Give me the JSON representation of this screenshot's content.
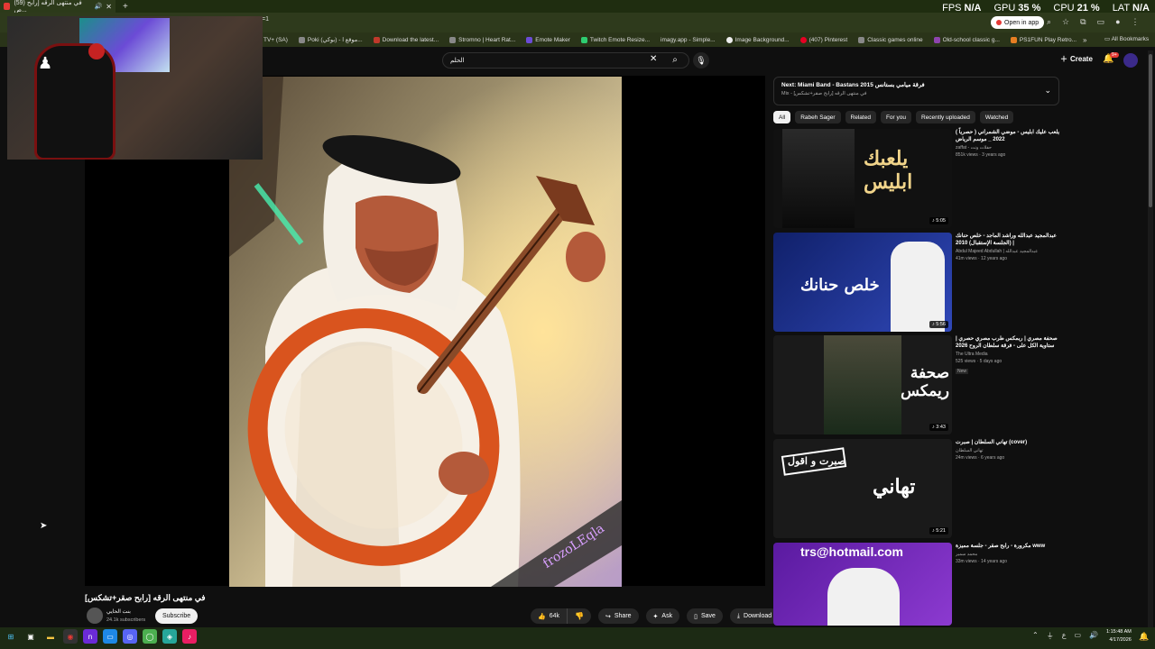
{
  "browser": {
    "tab_title": "(59) في منتهى الرقه [رابح ص...",
    "tab_badge": "🔊",
    "new_tab": "+",
    "address_text": "=1",
    "open_in_app": "Open in app",
    "bookmarks": [
      "TV+ (SA)",
      "Poki (بوكي) - موقع ا...",
      "Download the latest...",
      "Stromno | Heart Rat...",
      "Emote Maker",
      "Twitch Emote Resize...",
      "imagy.app - Simple...",
      "Image Background...",
      "(407) Pinterest",
      "Classic games online",
      "Old-school classic g...",
      "PS1FUN Play Retro..."
    ],
    "more_bookmarks": "»",
    "all_bookmarks": "All Bookmarks"
  },
  "overlay": {
    "fps_label": "FPS",
    "fps_value": "N/A",
    "gpu_label": "GPU",
    "gpu_value": "35 %",
    "cpu_label": "CPU",
    "cpu_value": "21 %",
    "lat_label": "LAT",
    "lat_value": "N/A"
  },
  "youtube": {
    "search_value": "الحلم",
    "create_label": "Create",
    "notif_count": "9+",
    "video": {
      "title": "في منتهى الرقه [رابح صقر+تشكس]",
      "channel": "بنت الحايي",
      "subscribers": "24.1k subscribers",
      "subscribe": "Subscribe",
      "likes": "64k",
      "share": "Share",
      "ask": "Ask",
      "save": "Save",
      "download": "Download",
      "watermark": "frozoLEqla"
    },
    "mix": {
      "next": "Next: Miami Band - Bastans فرقة ميامي بستانس 2015",
      "sub": "Mix - في منتهى الرقه [رابح صقر+تشكس]"
    },
    "chips": [
      "All",
      "Rabeh Sager",
      "Related",
      "For you",
      "Recently uploaded",
      "Watched"
    ],
    "recommendations": [
      {
        "title": "يلعب عليك ابليس - موضي الشمراني ( حصرياً ) 2022 _ موسم الرياض",
        "channel": "zaffat - حفلات ونت",
        "views": "851k views · 3 years ago",
        "duration": "5:05",
        "thumb_text": "يلعبك ابليس",
        "bg": "#1a1a1a"
      },
      {
        "title": "عبدالمجيد عبدالله وراشد الماجد - خلص حنانك (الجلسة الإستقبال) 2010 |",
        "channel": "Abdul Majeed Abdullah | عبدالمجيد عبدالله",
        "views": "41m views · 12 years ago",
        "duration": "5:56",
        "thumb_text": "خلص حنانك",
        "bg": "#1a2a7a"
      },
      {
        "title": "صحفة مصري | ريمكس طرب مصري حصري | ستاوية الكل على - فرقة سلطان الروح 2026",
        "channel": "The Ultra Media",
        "views": "525 views · 5 days ago",
        "badge": "New",
        "duration": "3:43",
        "thumb_text": "صحفة ريمكس",
        "bg": "#2a2a2a"
      },
      {
        "title": "تهاني السلطان | صبرت (cover)",
        "channel": "تهاني السلطان",
        "views": "24m views · 6 years ago",
        "duration": "5:21",
        "thumb_text": "صبرت و اقول",
        "bg": "#1d1d1d"
      },
      {
        "title": "مكرورة - رابح صقر - جلسة مميزة www",
        "channel": "محمد سمير",
        "views": "33m views · 14 years ago",
        "duration": "",
        "thumb_text": "trs@hotmail.com",
        "bg": "#5a1aa0"
      }
    ]
  },
  "taskbar": {
    "time": "1:15:48 AM",
    "date": "4/17/2026"
  }
}
